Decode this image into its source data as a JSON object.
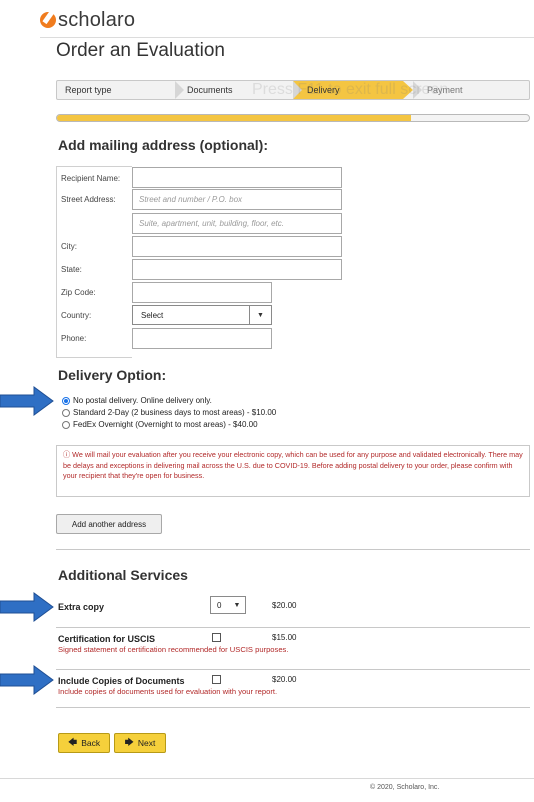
{
  "header": {
    "logo_text": "scholaro",
    "brand_color": "#f07c1e"
  },
  "page_title": "Order an Evaluation",
  "stepper": {
    "steps": [
      "Report type",
      "Documents",
      "Delivery",
      "Payment"
    ],
    "active": "Delivery",
    "watermark": "Press  F11  to exit full screen",
    "active_color": "#f4c542"
  },
  "progress": {
    "percent": 75
  },
  "mailing": {
    "heading": "Add mailing address (optional):",
    "recipient_label": "Recipient Name:",
    "street_label": "Street Address:",
    "street_placeholder": "Street and number / P.O. box",
    "street2_placeholder": "Suite, apartment, unit, building, floor, etc.",
    "city_label": "City:",
    "state_label": "State:",
    "zip_label": "Zip Code:",
    "country_label": "Country:",
    "country_value": "Select",
    "phone_label": "Phone:"
  },
  "delivery": {
    "heading": "Delivery Option:",
    "options": [
      {
        "label": "No postal delivery. Online delivery only.",
        "checked": true
      },
      {
        "label": "Standard 2-Day (2 business days to most areas) - $10.00",
        "checked": false
      },
      {
        "label": "FedEx Overnight (Overnight to most areas) - $40.00",
        "checked": false
      }
    ],
    "notice": "ⓘ We will mail your evaluation after you receive your electronic copy, which can be used for any purpose and validated electronically. There may be delays and exceptions in delivering mail across the U.S. due to COVID-19. Before adding postal delivery to your order, please confirm with your recipient that they're open for business.",
    "add_address_label": "Add another address"
  },
  "services": {
    "heading": "Additional Services",
    "extra_copy": {
      "name": "Extra copy",
      "qty": "0",
      "price": "$20.00"
    },
    "uscis": {
      "name": "Certification for USCIS",
      "price": "$15.00",
      "note": "Signed statement of certification recommended for USCIS purposes."
    },
    "copies": {
      "name": "Include Copies of Documents",
      "price": "$20.00",
      "note": "Include copies of documents used for evaluation with your report."
    }
  },
  "nav": {
    "back_label": "Back",
    "next_label": "Next"
  },
  "footer": {
    "copyright": "© 2020, Scholaro, Inc."
  },
  "colors": {
    "annotation_arrow": "#2f6fc4",
    "notice_text": "#b22a2a",
    "button_yellow": "#f5d03b"
  }
}
